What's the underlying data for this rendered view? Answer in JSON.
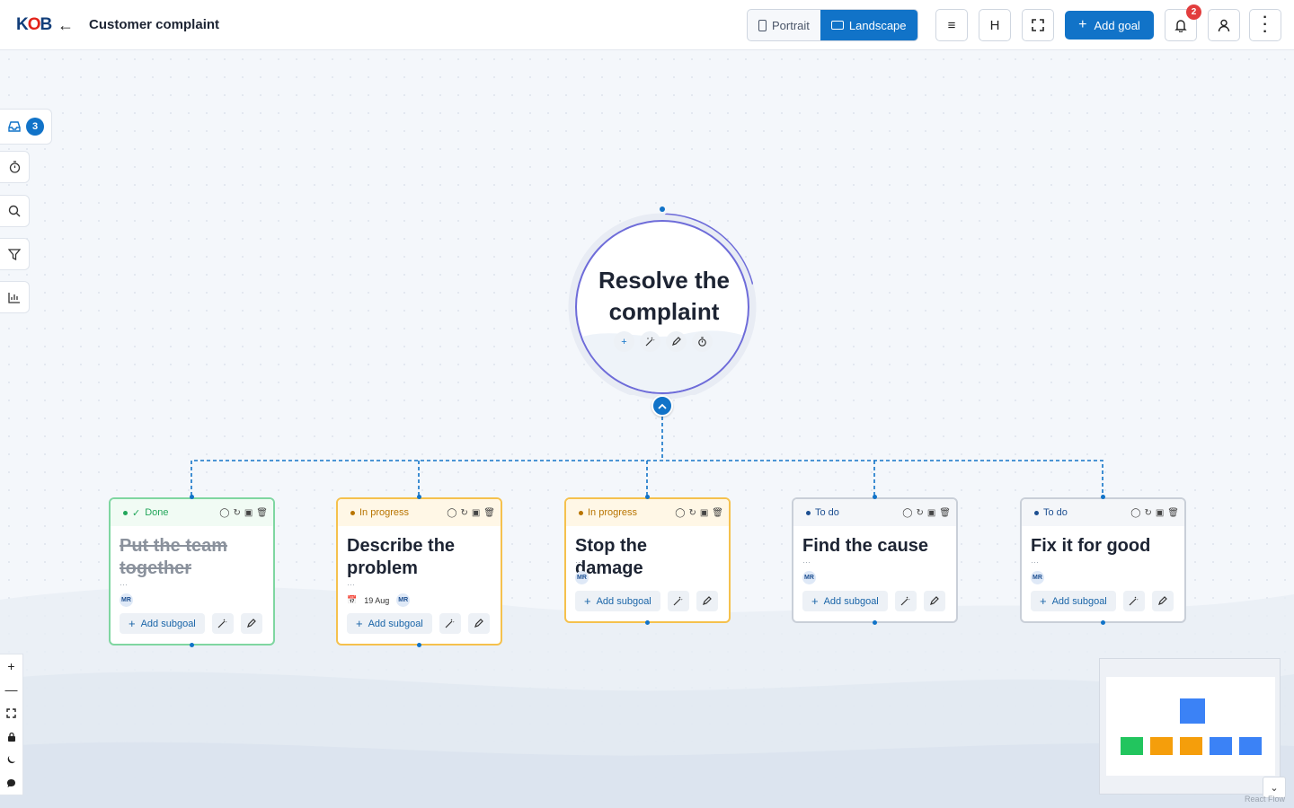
{
  "header": {
    "logo_main": "K",
    "logo_accent": "B",
    "logo_mid": "O",
    "title": "Customer complaint",
    "view_options": [
      {
        "label": "Portrait",
        "active": false
      },
      {
        "label": "Landscape",
        "active": true
      }
    ],
    "add_goal_label": "Add goal",
    "h_label": "H",
    "notifications_count": "2"
  },
  "sidebar": {
    "inbox_count": "3"
  },
  "root_goal": {
    "title": "Resolve the complaint",
    "progress": 0.2
  },
  "subgoals": [
    {
      "title": "Put the team together",
      "status": "Done",
      "status_color": "#22a65a",
      "border_color": "#7fd6a1",
      "head_bg": "#f1fbf4",
      "done": true,
      "date": "",
      "avatar": "MR",
      "add_label": "Add subgoal"
    },
    {
      "title": "Describe the problem",
      "status": "In progress",
      "status_color": "#b87400",
      "border_color": "#f5c14d",
      "head_bg": "#fff7e6",
      "done": false,
      "date": "19 Aug",
      "avatar": "MR",
      "add_label": "Add subgoal"
    },
    {
      "title": "Stop the damage",
      "status": "In progress",
      "status_color": "#b87400",
      "border_color": "#f5c14d",
      "head_bg": "#fff7e6",
      "done": false,
      "date": "",
      "avatar": "MR",
      "add_label": "Add subgoal"
    },
    {
      "title": "Find the cause",
      "status": "To do",
      "status_color": "#1d4f91",
      "border_color": "#c9cfd8",
      "head_bg": "#f4f6f9",
      "done": false,
      "date": "",
      "avatar": "MR",
      "add_label": "Add subgoal"
    },
    {
      "title": "Fix it for good",
      "status": "To do",
      "status_color": "#1d4f91",
      "border_color": "#c9cfd8",
      "head_bg": "#f4f6f9",
      "done": false,
      "date": "",
      "avatar": "MR",
      "add_label": "Add subgoal"
    }
  ],
  "minimap": {
    "root_color": "#3b82f6",
    "node_colors": [
      "#22c55e",
      "#f59e0b",
      "#f59e0b",
      "#3b82f6",
      "#3b82f6"
    ],
    "attribution": "React Flow"
  },
  "colors": {
    "accent": "#1173c8",
    "root_border": "#6e6cd9",
    "edge": "#1173c8"
  }
}
